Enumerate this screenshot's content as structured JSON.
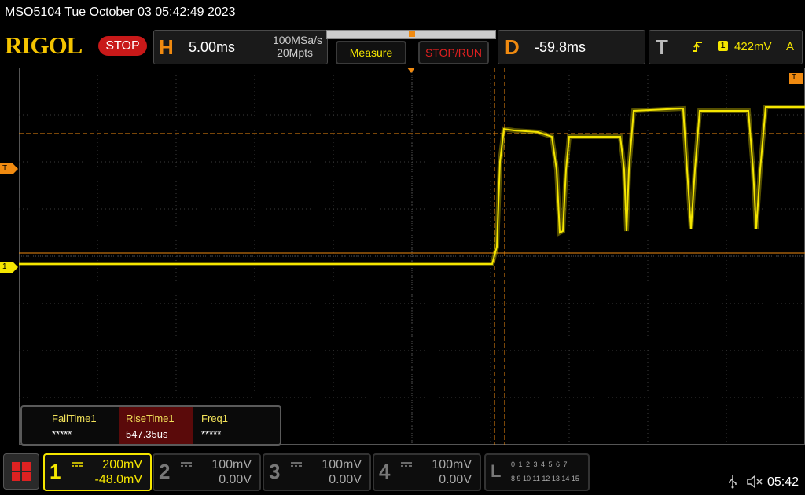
{
  "title": "MSO5104  Tue October 03 05:42:49 2023",
  "logo": "RIGOL",
  "status": "STOP",
  "horizontal": {
    "letter": "H",
    "timebase": "5.00ms",
    "sample_rate": "100MSa/s",
    "memory": "20Mpts"
  },
  "buttons": {
    "measure": "Measure",
    "stoprun": "STOP/RUN"
  },
  "delay": {
    "letter": "D",
    "value": "-59.8ms"
  },
  "trigger": {
    "letter": "T",
    "source": "1",
    "level": "422mV",
    "mode": "A"
  },
  "markers": {
    "trigger_level": "T",
    "channel1": "1"
  },
  "measurements": [
    {
      "label": "FallTime1",
      "value": "*****"
    },
    {
      "label": "RiseTime1",
      "value": "547.35us"
    },
    {
      "label": "Freq1",
      "value": "*****"
    }
  ],
  "channels": [
    {
      "num": "1",
      "scale": "200mV",
      "offset": "-48.0mV",
      "active": true,
      "color": "#f5e600"
    },
    {
      "num": "2",
      "scale": "100mV",
      "offset": "0.00V",
      "active": false,
      "color": "#888888"
    },
    {
      "num": "3",
      "scale": "100mV",
      "offset": "0.00V",
      "active": false,
      "color": "#888888"
    },
    {
      "num": "4",
      "scale": "100mV",
      "offset": "0.00V",
      "active": false,
      "color": "#888888"
    }
  ],
  "logic": {
    "letter": "L",
    "row1": "0 1 2 3  4 5 6 7",
    "row2": "8 9 10 11 12 13 14 15"
  },
  "clock": "05:42",
  "colors": {
    "trace": "#f5e600",
    "cursor": "#f08a10",
    "grid": "#3c3c3c",
    "accent": "#f08a10"
  }
}
